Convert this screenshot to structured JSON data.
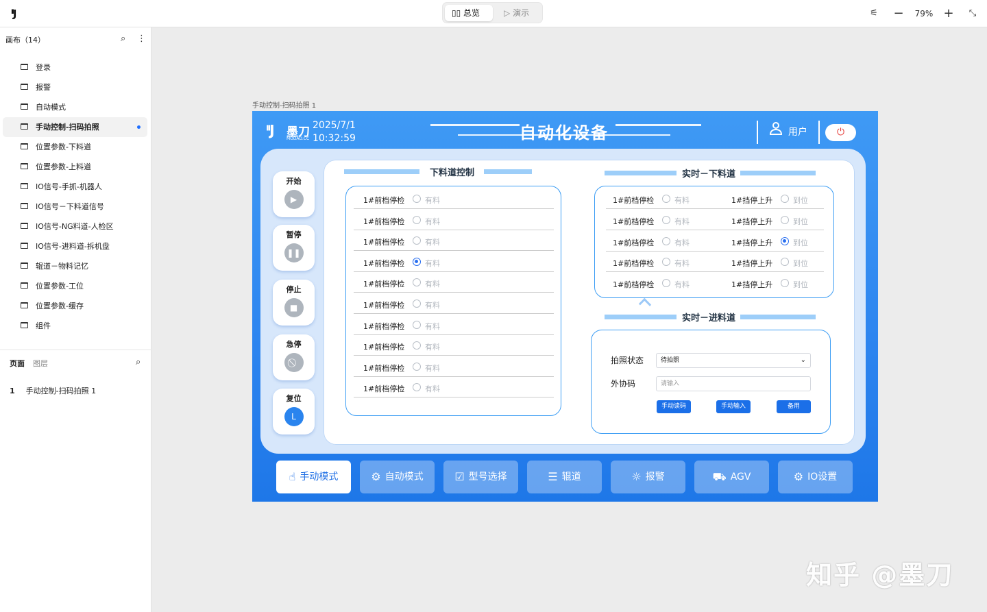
{
  "topbar": {
    "overview": "总览",
    "present": "演示",
    "zoom": "79%"
  },
  "sidebar": {
    "canvas_title": "画布（14）",
    "pages": [
      "登录",
      "报警",
      "自动模式",
      "手动控制-扫码拍照",
      "位置参数-下料道",
      "位置参数-上料道",
      "IO信号-手抓-机器人",
      "IO信号－下料道信号",
      "IO信号-NG料道-人检区",
      "IO信号-进料道-拆机盘",
      "辊道－物料记忆",
      "位置参数-工位",
      "位置参数-缓存",
      "组件"
    ],
    "tab_page": "页面",
    "tab_layer": "图层",
    "layer_index": "1",
    "layer_name": "手动控制-扫码拍照 1"
  },
  "stage": {
    "label": "手动控制-扫码拍照 1"
  },
  "screen": {
    "brand": "墨刀",
    "brand_sub": "MODAO.CC",
    "date": "2025/7/1",
    "time": "10:32:59",
    "title": "自动化设备",
    "user": "用户",
    "side_buttons": [
      "开始",
      "暂停",
      "停止",
      "急停",
      "复位"
    ],
    "left": {
      "title": "下料道控制",
      "rows": [
        "1#前档停检",
        "1#前档停检",
        "1#前档停检",
        "1#前档停检",
        "1#前档停检",
        "1#前档停检",
        "1#前档停检",
        "1#前档停检",
        "1#前档停检",
        "1#前档停检"
      ],
      "option": "有料",
      "selected_index": 3
    },
    "rt": {
      "title": "实时－下料道",
      "left_rows": [
        "1#前档停检",
        "1#前档停检",
        "1#前档停检",
        "1#前档停检",
        "1#前档停检"
      ],
      "left_option": "有料",
      "right_rows": [
        "1#挡停上升",
        "1#挡停上升",
        "1#挡停上升",
        "1#挡停上升",
        "1#挡停上升"
      ],
      "right_option": "到位",
      "right_selected_index": 2
    },
    "rb": {
      "title": "实时－进料道",
      "photo_label": "拍照状态",
      "photo_value": "待拍照",
      "code_label": "外协码",
      "code_placeholder": "请输入",
      "btn_read": "手动读码",
      "btn_input": "手动输入",
      "btn_spare": "备用"
    },
    "nav": [
      "手动模式",
      "自动模式",
      "型号选择",
      "辊道",
      "报警",
      "AGV",
      "IO设置"
    ]
  },
  "watermark": "知乎 @墨刀"
}
